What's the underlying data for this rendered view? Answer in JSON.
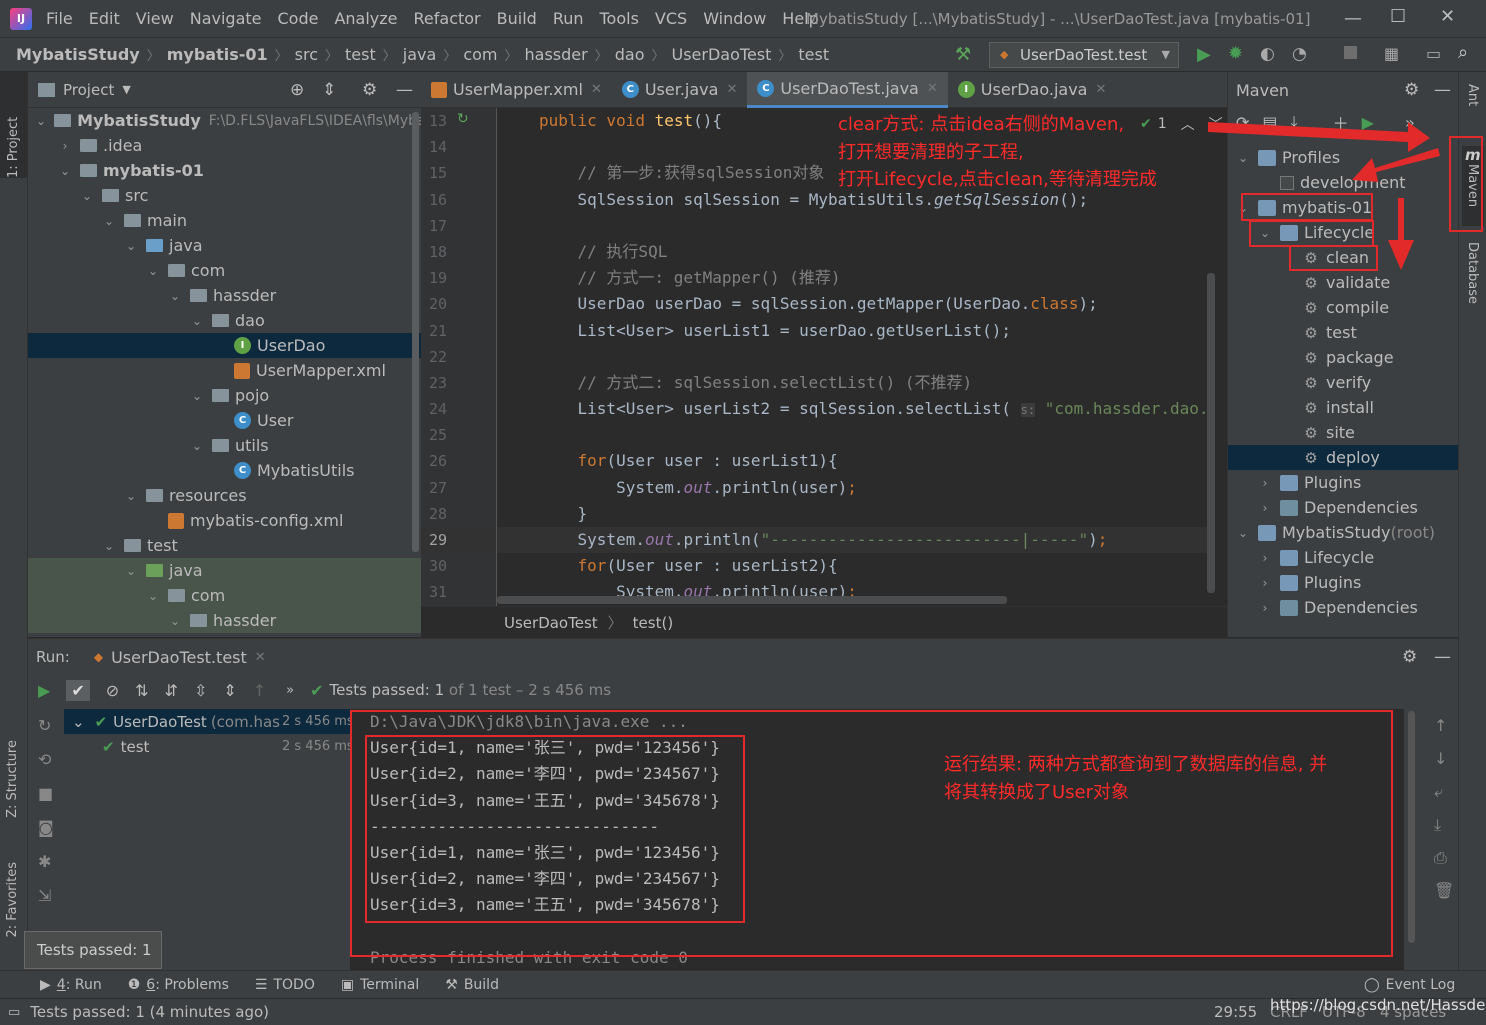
{
  "menubar": {
    "items": [
      "File",
      "Edit",
      "View",
      "Navigate",
      "Code",
      "Analyze",
      "Refactor",
      "Build",
      "Run",
      "Tools",
      "VCS",
      "Window",
      "Help"
    ],
    "window_title": "MybatisStudy [...\\MybatisStudy] - ...\\UserDaoTest.java [mybatis-01]"
  },
  "navbar": {
    "crumbs": [
      "MybatisStudy",
      "mybatis-01",
      "src",
      "test",
      "java",
      "com",
      "hassder",
      "dao",
      "UserDaoTest",
      "test"
    ],
    "run_config": "UserDaoTest.test"
  },
  "left_strip": {
    "project": "1: Project",
    "structure": "Z: Structure",
    "favorites": "2: Favorites"
  },
  "right_strip": {
    "ant": "Ant",
    "maven": "Maven",
    "database": "Database"
  },
  "project": {
    "title": "Project",
    "root_path": "F:\\D.FLS\\JavaFLS\\IDEA\\fls\\Myba",
    "tree": [
      {
        "label": "MybatisStudy",
        "depth": 0,
        "arrow": "down",
        "icon": "module",
        "bold": true
      },
      {
        "label": ".idea",
        "depth": 1,
        "arrow": "right",
        "icon": "folder"
      },
      {
        "label": "mybatis-01",
        "depth": 1,
        "arrow": "down",
        "icon": "module",
        "bold": true
      },
      {
        "label": "src",
        "depth": 2,
        "arrow": "down",
        "icon": "folder"
      },
      {
        "label": "main",
        "depth": 3,
        "arrow": "down",
        "icon": "folder"
      },
      {
        "label": "java",
        "depth": 4,
        "arrow": "down",
        "icon": "folder-blue"
      },
      {
        "label": "com",
        "depth": 5,
        "arrow": "down",
        "icon": "package"
      },
      {
        "label": "hassder",
        "depth": 6,
        "arrow": "down",
        "icon": "package"
      },
      {
        "label": "dao",
        "depth": 7,
        "arrow": "down",
        "icon": "package"
      },
      {
        "label": "UserDao",
        "depth": 8,
        "arrow": "",
        "icon": "interface",
        "selected": true
      },
      {
        "label": "UserMapper.xml",
        "depth": 8,
        "arrow": "",
        "icon": "xml"
      },
      {
        "label": "pojo",
        "depth": 7,
        "arrow": "down",
        "icon": "package"
      },
      {
        "label": "User",
        "depth": 8,
        "arrow": "",
        "icon": "class"
      },
      {
        "label": "utils",
        "depth": 7,
        "arrow": "down",
        "icon": "package"
      },
      {
        "label": "MybatisUtils",
        "depth": 8,
        "arrow": "",
        "icon": "class"
      },
      {
        "label": "resources",
        "depth": 4,
        "arrow": "down",
        "icon": "folder"
      },
      {
        "label": "mybatis-config.xml",
        "depth": 5,
        "arrow": "",
        "icon": "xml"
      },
      {
        "label": "test",
        "depth": 3,
        "arrow": "down",
        "icon": "folder"
      },
      {
        "label": "java",
        "depth": 4,
        "arrow": "down",
        "icon": "folder-green",
        "test": true
      },
      {
        "label": "com",
        "depth": 5,
        "arrow": "down",
        "icon": "package",
        "test": true
      },
      {
        "label": "hassder",
        "depth": 6,
        "arrow": "down",
        "icon": "package",
        "test": true
      }
    ]
  },
  "editor": {
    "tabs": [
      {
        "label": "UserMapper.xml",
        "icon": "xml"
      },
      {
        "label": "User.java",
        "icon": "class"
      },
      {
        "label": "UserDaoTest.java",
        "icon": "class",
        "active": true
      },
      {
        "label": "UserDao.java",
        "icon": "interface"
      }
    ],
    "line_numbers": [
      "13",
      "14",
      "15",
      "16",
      "17",
      "18",
      "19",
      "20",
      "21",
      "22",
      "23",
      "24",
      "25",
      "26",
      "27",
      "28",
      "29",
      "30",
      "31"
    ],
    "inspection_count": "1",
    "breadcrumb": [
      "UserDaoTest",
      "test()"
    ]
  },
  "maven": {
    "title": "Maven",
    "tree": [
      {
        "label": "Profiles",
        "depth": 0,
        "arrow": "down",
        "icon": "profiles"
      },
      {
        "label": "development",
        "depth": 1,
        "arrow": "",
        "icon": "checkbox"
      },
      {
        "label": "mybatis-01",
        "depth": 0,
        "arrow": "down",
        "icon": "maven"
      },
      {
        "label": "Lifecycle",
        "depth": 1,
        "arrow": "down",
        "icon": "lifecycle"
      },
      {
        "label": "clean",
        "depth": 2,
        "arrow": "",
        "icon": "gear"
      },
      {
        "label": "validate",
        "depth": 2,
        "arrow": "",
        "icon": "gear"
      },
      {
        "label": "compile",
        "depth": 2,
        "arrow": "",
        "icon": "gear"
      },
      {
        "label": "test",
        "depth": 2,
        "arrow": "",
        "icon": "gear"
      },
      {
        "label": "package",
        "depth": 2,
        "arrow": "",
        "icon": "gear"
      },
      {
        "label": "verify",
        "depth": 2,
        "arrow": "",
        "icon": "gear"
      },
      {
        "label": "install",
        "depth": 2,
        "arrow": "",
        "icon": "gear"
      },
      {
        "label": "site",
        "depth": 2,
        "arrow": "",
        "icon": "gear"
      },
      {
        "label": "deploy",
        "depth": 2,
        "arrow": "",
        "icon": "gear",
        "selected": true
      },
      {
        "label": "Plugins",
        "depth": 1,
        "arrow": "right",
        "icon": "lifecycle"
      },
      {
        "label": "Dependencies",
        "depth": 1,
        "arrow": "right",
        "icon": "deps"
      },
      {
        "label": "MybatisStudy",
        "suffix": " (root)",
        "depth": 0,
        "arrow": "down",
        "icon": "maven"
      },
      {
        "label": "Lifecycle",
        "depth": 1,
        "arrow": "right",
        "icon": "lifecycle"
      },
      {
        "label": "Plugins",
        "depth": 1,
        "arrow": "right",
        "icon": "lifecycle"
      },
      {
        "label": "Dependencies",
        "depth": 1,
        "arrow": "right",
        "icon": "deps"
      }
    ]
  },
  "run": {
    "label": "Run:",
    "tab": "UserDaoTest.test",
    "status": "Tests passed:",
    "status_count": "1",
    "status_rest": "of 1 test – 2 s 456 ms",
    "tree": [
      {
        "label": "UserDaoTest",
        "detail": "(com.has",
        "time": "2 s 456 ms"
      },
      {
        "label": "test",
        "detail": "",
        "time": "2 s 456 ms"
      }
    ],
    "console": [
      "D:\\Java\\JDK\\jdk8\\bin\\java.exe ...",
      "User{id=1, name='张三', pwd='123456'}",
      "User{id=2, name='李四', pwd='234567'}",
      "User{id=3, name='王五', pwd='345678'}",
      "------------------------------",
      "User{id=1, name='张三', pwd='123456'}",
      "User{id=2, name='李四', pwd='234567'}",
      "User{id=3, name='王五', pwd='345678'}",
      "",
      "Process finished with exit code 0"
    ],
    "tooltip": "Tests passed: 1"
  },
  "toolwindows": [
    {
      "num": "4",
      "label": ": Run"
    },
    {
      "num": "6",
      "label": ": Problems"
    },
    {
      "num": "",
      "label": "TODO"
    },
    {
      "num": "",
      "label": "Terminal"
    },
    {
      "num": "",
      "label": "Build"
    }
  ],
  "event_log": "Event Log",
  "statusbar": {
    "message": "Tests passed: 1 (4 minutes ago)",
    "position": "29:55",
    "line_sep": "CRLF",
    "encoding": "UTF-8",
    "indent": "4 spaces",
    "watermark": "https://blog.csdn.net/Hassder"
  },
  "annotations": {
    "maven_line1": "clear方式: 点击idea右侧的Maven,",
    "maven_line2": "打开想要清理的子工程,",
    "maven_line3": "打开Lifecycle,点击clean,等待清理完成",
    "result_line1": "运行结果: 两种方式都查询到了数据库的信息, 并",
    "result_line2": "将其转换成了User对象"
  },
  "colors": {
    "accent": "#4a88c7",
    "annotation": "#e22a2a",
    "pass": "#499c54"
  }
}
